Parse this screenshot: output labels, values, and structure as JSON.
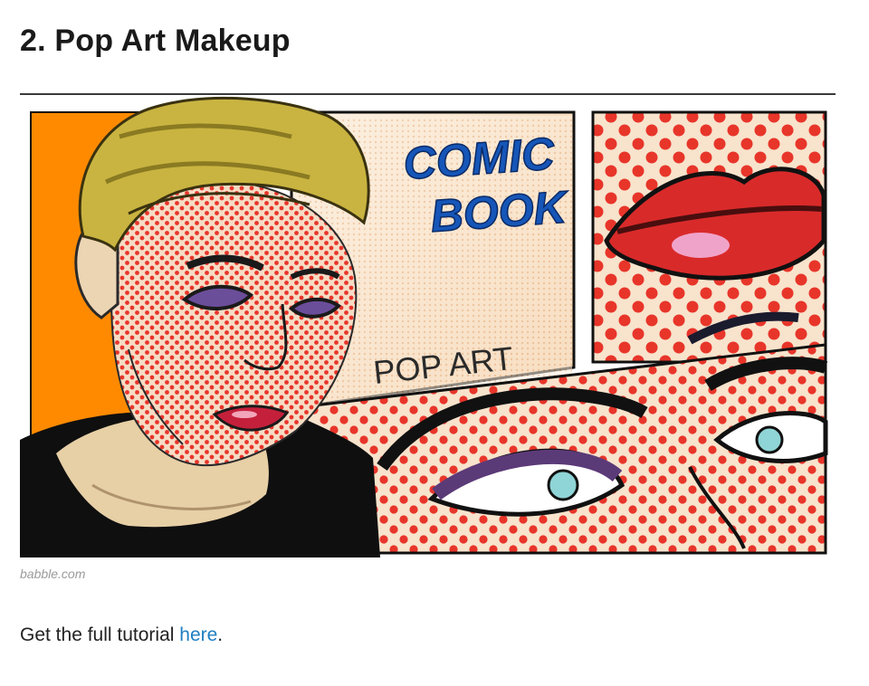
{
  "article": {
    "heading": "2. Pop Art Makeup",
    "image": {
      "alt": "Woman with pop art comic-book makeup",
      "caption_lines": [
        "COMIC",
        "BOOK"
      ],
      "panel_text": "POP ART"
    },
    "credit": "babble.com",
    "body_prefix": "Get the full tutorial ",
    "body_link": "here",
    "body_suffix": "."
  },
  "colors": {
    "link": "#1f7ec2",
    "dot_red": "#e8352a",
    "comic_blue": "#1656b8",
    "background_orange": "#ff8a00",
    "hair_yellow": "#c9b441"
  }
}
